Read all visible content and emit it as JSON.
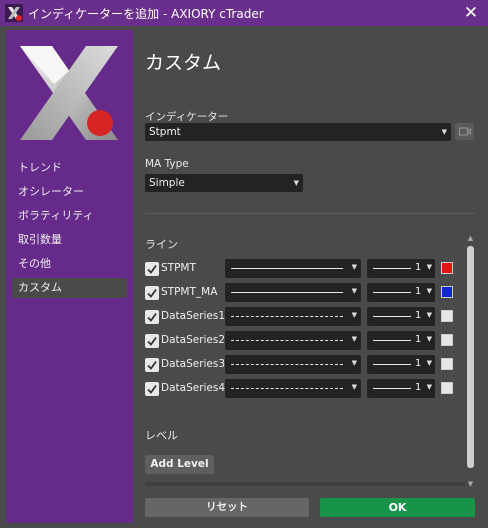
{
  "window": {
    "title": "インディケーターを追加 - AXIORY cTrader",
    "close_glyph": "✕",
    "app_icon": "cTrader-x-icon",
    "title_bar_color": "#6a2f8c"
  },
  "sidebar": {
    "background_color": "#652a8a",
    "logo": "axiory-x-logo",
    "items": [
      {
        "label": "トレンド"
      },
      {
        "label": "オシレーター"
      },
      {
        "label": "ボラティリティ"
      },
      {
        "label": "取引数量"
      },
      {
        "label": "その他"
      },
      {
        "label": "カスタム",
        "active": true
      }
    ]
  },
  "main": {
    "title": "カスタム",
    "indicator": {
      "label": "インディケーター",
      "value": "Stpmt",
      "side_icon": "camera-icon"
    },
    "ma_type": {
      "label": "MA Type",
      "value": "Simple"
    },
    "lines": {
      "title": "ライン",
      "rows": [
        {
          "name": "STPMT",
          "checked": true,
          "style": "solid",
          "width": "1",
          "color": "#e81212"
        },
        {
          "name": "STPMT_MA",
          "checked": true,
          "style": "solid",
          "width": "1",
          "color": "#1024d8"
        },
        {
          "name": "DataSeries1",
          "checked": true,
          "style": "dashed",
          "width": "1",
          "color": "#e6e6e6"
        },
        {
          "name": "DataSeries2",
          "checked": true,
          "style": "dashed",
          "width": "1",
          "color": "#e6e6e6"
        },
        {
          "name": "DataSeries3",
          "checked": true,
          "style": "dashed",
          "width": "1",
          "color": "#e6e6e6"
        },
        {
          "name": "DataSeries4",
          "checked": true,
          "style": "dashed",
          "width": "1",
          "color": "#e6e6e6"
        }
      ]
    },
    "levels": {
      "title": "レベル",
      "add_button": "Add Level"
    }
  },
  "footer": {
    "reset_label": "リセット",
    "ok_label": "OK",
    "ok_color": "#18944a"
  }
}
